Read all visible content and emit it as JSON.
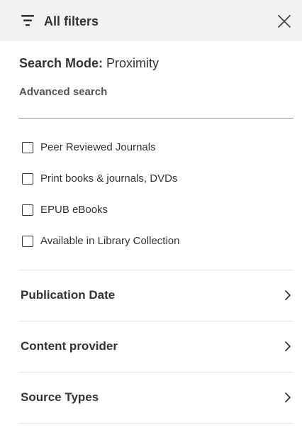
{
  "header": {
    "title": "All filters",
    "filter_icon": "filter-icon",
    "close_icon": "close-icon"
  },
  "search_mode": {
    "label": "Search Mode:",
    "value": "Proximity"
  },
  "advanced_search": "Advanced search",
  "checkboxes": [
    {
      "label": "Peer Reviewed Journals",
      "checked": false
    },
    {
      "label": "Print books & journals, DVDs",
      "checked": false
    },
    {
      "label": "EPUB eBooks",
      "checked": false
    },
    {
      "label": "Available in Library Collection",
      "checked": false
    }
  ],
  "facets": [
    {
      "label": "Publication Date",
      "icon": "chevron-right-icon"
    },
    {
      "label": "Content provider",
      "icon": "chevron-right-icon"
    },
    {
      "label": "Source Types",
      "icon": "chevron-right-icon"
    }
  ],
  "colors": {
    "header_bg": "#f2f2f2",
    "text": "#333333",
    "muted_text": "#555555"
  }
}
